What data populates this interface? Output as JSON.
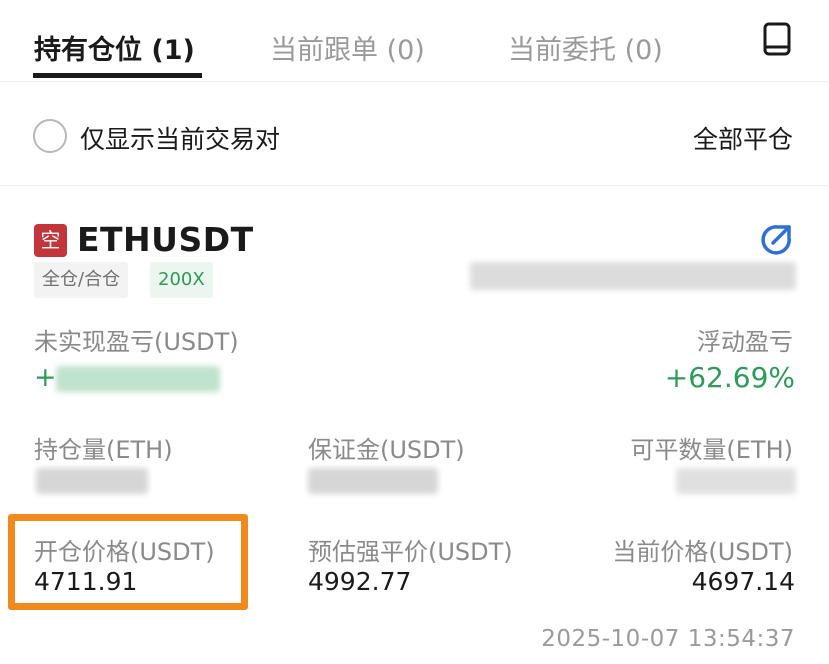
{
  "tabs": [
    {
      "label": "持有仓位 (1)"
    },
    {
      "label": "当前跟单 (0)"
    },
    {
      "label": "当前委托 (0)"
    }
  ],
  "filter": {
    "only_current_pair_label": "仅显示当前交易对",
    "close_all_label": "全部平仓"
  },
  "position": {
    "side_badge": "空",
    "symbol": "ETHUSDT",
    "margin_mode": "全仓/合仓",
    "leverage": "200X",
    "unrealized_pnl_label": "未实现盈亏(USDT)",
    "unrealized_pnl_prefix": "+",
    "floating_pnl_label": "浮动盈亏",
    "floating_pnl_value": "+62.69%",
    "size_label": "持仓量(ETH)",
    "margin_label": "保证金(USDT)",
    "closable_label": "可平数量(ETH)",
    "entry_price_label": "开仓价格(USDT)",
    "entry_price_value": "4711.91",
    "liq_price_label": "预估强平价(USDT)",
    "liq_price_value": "4992.77",
    "mark_price_label": "当前价格(USDT)",
    "mark_price_value": "4697.14",
    "timestamp": "2025-10-07 13:54:37"
  },
  "colors": {
    "accent_green": "#2f9a5a",
    "short_red": "#c2353a",
    "link_blue": "#2f6fd6",
    "highlight_orange": "#f08a1c"
  }
}
